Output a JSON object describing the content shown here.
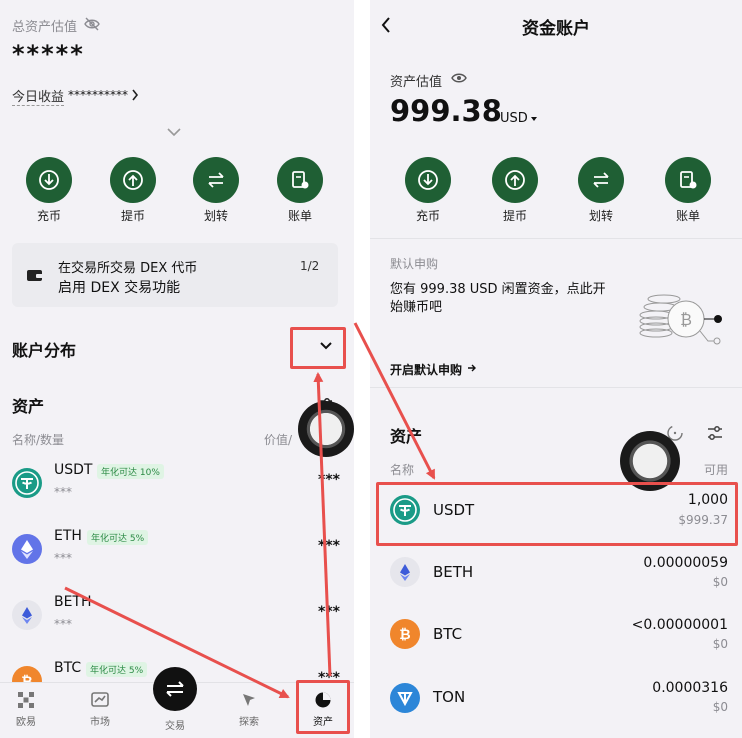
{
  "left": {
    "total_label": "总资产估值",
    "total_masked": "*****",
    "today_label": "今日收益",
    "today_masked": "**********",
    "actions": [
      {
        "label": "充币",
        "icon": "deposit-icon"
      },
      {
        "label": "提币",
        "icon": "withdraw-icon"
      },
      {
        "label": "划转",
        "icon": "transfer-icon"
      },
      {
        "label": "账单",
        "icon": "bill-icon"
      }
    ],
    "banner": {
      "line1": "在交易所交易 DEX 代币",
      "line2": "启用 DEX 交易功能",
      "page": "1/2"
    },
    "distribution_label": "账户分布",
    "assets_title": "资产",
    "col_name": "名称/数量",
    "col_value": "价值/",
    "assets": [
      {
        "symbol": "USDT",
        "badge": "年化可达 10%",
        "qty": "***",
        "val": "***"
      },
      {
        "symbol": "ETH",
        "badge": "年化可达 5%",
        "qty": "***",
        "val": "***"
      },
      {
        "symbol": "BETH",
        "badge": "",
        "qty": "***",
        "val": "***"
      },
      {
        "symbol": "BTC",
        "badge": "年化可达 5%",
        "qty": "",
        "val": "***"
      }
    ],
    "nav": [
      "欧易",
      "市场",
      "交易",
      "探索",
      "资产"
    ]
  },
  "right": {
    "title": "资金账户",
    "est_label": "资产估值",
    "amount": "999.38",
    "currency": "USD",
    "actions": [
      {
        "label": "充币",
        "icon": "deposit-icon"
      },
      {
        "label": "提币",
        "icon": "withdraw-icon"
      },
      {
        "label": "划转",
        "icon": "transfer-icon"
      },
      {
        "label": "账单",
        "icon": "bill-icon"
      }
    ],
    "promo": {
      "label": "默认申购",
      "line1": "您有 999.38 USD 闲置资金，点此开",
      "line2": "始赚币吧",
      "link": "开启默认申购"
    },
    "assets_title": "资产",
    "col_name": "名称",
    "col_value": "可用",
    "assets": [
      {
        "symbol": "USDT",
        "amount": "1,000",
        "usd": "$999.37"
      },
      {
        "symbol": "BETH",
        "amount": "0.00000059",
        "usd": "$0"
      },
      {
        "symbol": "BTC",
        "amount": "<0.00000001",
        "usd": "$0"
      },
      {
        "symbol": "TON",
        "amount": "0.0000316",
        "usd": "$0"
      }
    ]
  },
  "colors": {
    "accent": "#1f5f34",
    "annotation": "#e8504d",
    "tether": "#1a9b87",
    "eth": "#6274e8",
    "btc": "#f0862c",
    "ton": "#2c86d8"
  }
}
